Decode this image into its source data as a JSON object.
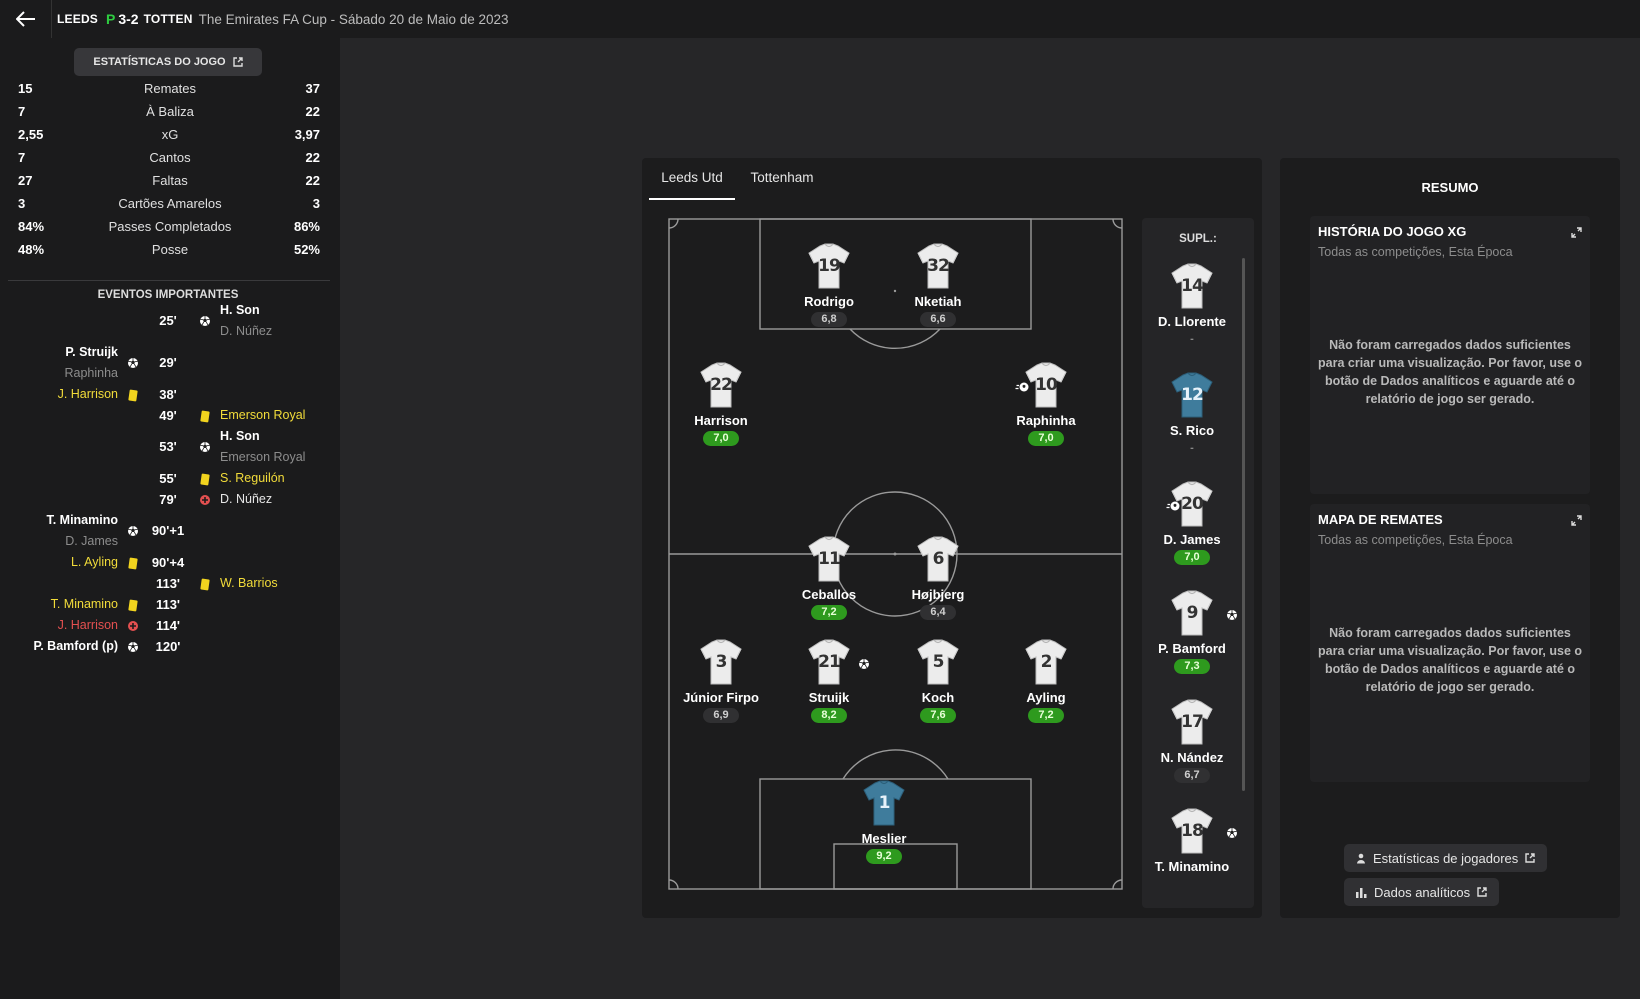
{
  "header": {
    "home_team": "LEEDS",
    "result": "P",
    "score": "3-2",
    "away_team": "TOTTEN",
    "competition": "The Emirates FA Cup - Sábado 20 de Maio de 2023"
  },
  "stats": {
    "button_label": "ESTATÍSTICAS DO JOGO",
    "rows": [
      {
        "home": "15",
        "label": "Remates",
        "away": "37"
      },
      {
        "home": "7",
        "label": "À Baliza",
        "away": "22"
      },
      {
        "home": "2,55",
        "label": "xG",
        "away": "3,97"
      },
      {
        "home": "7",
        "label": "Cantos",
        "away": "22"
      },
      {
        "home": "27",
        "label": "Faltas",
        "away": "22"
      },
      {
        "home": "3",
        "label": "Cartões Amarelos",
        "away": "3"
      },
      {
        "home": "84%",
        "label": "Passes Completados",
        "away": "86%"
      },
      {
        "home": "48%",
        "label": "Posse",
        "away": "52%"
      }
    ]
  },
  "events": {
    "title": "EVENTOS IMPORTANTES",
    "items": [
      {
        "minute": "25'",
        "away_name": "H. Son",
        "away_sub": "D. Núñez",
        "away_icon": "goal-icon"
      },
      {
        "minute": "29'",
        "home_name": "P. Struijk",
        "home_sub": "Raphinha",
        "home_icon": "goal-icon"
      },
      {
        "minute": "38'",
        "home_name": "J. Harrison",
        "home_icon": "yellow-card-icon"
      },
      {
        "minute": "49'",
        "away_name": "Emerson Royal",
        "away_icon": "yellow-card-icon"
      },
      {
        "minute": "53'",
        "away_name": "H. Son",
        "away_sub": "Emerson Royal",
        "away_icon": "goal-icon"
      },
      {
        "minute": "55'",
        "away_name": "S. Reguilón",
        "away_icon": "yellow-card-icon"
      },
      {
        "minute": "79'",
        "away_name": "D. Núñez",
        "away_icon": "injury-icon"
      },
      {
        "minute": "90'+1",
        "home_name": "T. Minamino",
        "home_sub": "D. James",
        "home_icon": "goal-icon"
      },
      {
        "minute": "90'+4",
        "home_name": "L. Ayling",
        "home_icon": "yellow-card-icon"
      },
      {
        "minute": "113'",
        "away_name": "W. Barrios",
        "away_icon": "yellow-card-icon"
      },
      {
        "minute": "113'",
        "home_name": "T. Minamino",
        "home_icon": "yellow-card-icon"
      },
      {
        "minute": "114'",
        "home_name": "J. Harrison",
        "home_icon": "injury-icon"
      },
      {
        "minute": "120'",
        "home_name": "P. Bamford (p)",
        "home_icon": "goal-icon"
      }
    ]
  },
  "lineup": {
    "tabs": [
      "Leeds Utd",
      "Tottenham"
    ],
    "players": [
      {
        "number": "19",
        "name": "Rodrigo",
        "rating": "6,8",
        "kit": "outfield"
      },
      {
        "number": "32",
        "name": "Nketiah",
        "rating": "6,6",
        "kit": "outfield"
      },
      {
        "number": "22",
        "name": "Harrison",
        "rating": "7,0",
        "kit": "outfield"
      },
      {
        "number": "10",
        "name": "Raphinha",
        "rating": "7,0",
        "kit": "outfield",
        "event_icon": "assist-icon"
      },
      {
        "number": "11",
        "name": "Ceballos",
        "rating": "7,2",
        "kit": "outfield"
      },
      {
        "number": "6",
        "name": "Højbjerg",
        "rating": "6,4",
        "kit": "outfield"
      },
      {
        "number": "3",
        "name": "Júnior Firpo",
        "rating": "6,9",
        "kit": "outfield"
      },
      {
        "number": "21",
        "name": "Struijk",
        "rating": "8,2",
        "kit": "outfield",
        "event_icon": "goal-icon"
      },
      {
        "number": "5",
        "name": "Koch",
        "rating": "7,6",
        "kit": "outfield"
      },
      {
        "number": "2",
        "name": "Ayling",
        "rating": "7,2",
        "kit": "outfield"
      },
      {
        "number": "1",
        "name": "Meslier",
        "rating": "9,2",
        "kit": "goalkeeper"
      }
    ],
    "subs_title": "SUPL.:",
    "subs": [
      {
        "number": "14",
        "name": "D. Llorente",
        "rating": "-",
        "kit": "outfield"
      },
      {
        "number": "12",
        "name": "S. Rico",
        "rating": "-",
        "kit": "goalkeeper"
      },
      {
        "number": "20",
        "name": "D. James",
        "rating": "7,0",
        "kit": "outfield",
        "event_icon": "assist-icon"
      },
      {
        "number": "9",
        "name": "P. Bamford",
        "rating": "7,3",
        "kit": "outfield",
        "event_icon": "goal-icon"
      },
      {
        "number": "17",
        "name": "N. Nández",
        "rating": "6,7",
        "kit": "outfield"
      },
      {
        "number": "18",
        "name": "T. Minamino",
        "rating": "",
        "kit": "outfield",
        "event_icon": "goal-icon"
      }
    ]
  },
  "resumo": {
    "title": "RESUMO",
    "cards": [
      {
        "title": "HISTÓRIA DO JOGO XG",
        "subtitle": "Todas as competições, Esta Época",
        "message": "Não foram carregados dados suficientes para criar uma visualização. Por favor, use o botão de Dados analíticos e aguarde até o relatório de jogo ser gerado."
      },
      {
        "title": "MAPA DE REMATES",
        "subtitle": "Todas as competições, Esta Época",
        "message": "Não foram carregados dados suficientes para criar uma visualização. Por favor, use o botão de Dados analíticos e aguarde até o relatório de jogo ser gerado."
      }
    ],
    "player_stats_button": "Estatísticas de jogadores",
    "analytics_button": "Dados analíticos"
  },
  "colors": {
    "accent_green": "#2ecc40",
    "rating_green": "#2e9a1e",
    "yellow_card": "#f2d41e",
    "injury_red": "#e45050"
  }
}
